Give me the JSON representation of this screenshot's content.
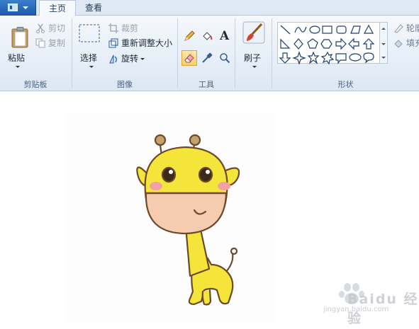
{
  "app_menu": {
    "icon": "paint-app-menu-icon"
  },
  "tabs": [
    {
      "label": "主页",
      "active": true
    },
    {
      "label": "查看",
      "active": false
    }
  ],
  "clipboard": {
    "paste_label": "粘贴",
    "cut_label": "剪切",
    "copy_label": "复制",
    "group_label": "剪贴板"
  },
  "image": {
    "select_label": "选择",
    "crop_label": "裁剪",
    "resize_label": "重新调整大小",
    "rotate_label": "旋转",
    "group_label": "图像"
  },
  "tools": {
    "items": [
      "pencil-icon",
      "fill-icon",
      "text-icon",
      "eraser-icon",
      "color-picker-icon",
      "magnifier-icon"
    ],
    "text_glyph": "A",
    "active": "eraser-icon",
    "group_label": "工具"
  },
  "brushes": {
    "label": "刷子"
  },
  "shapes": {
    "outline_label": "轮廓",
    "fill_label": "填充",
    "group_label": "形状"
  },
  "watermark": {
    "text": "Baidu 经验",
    "url": "jingyan.baidu.com"
  },
  "colors": {
    "accent": "#1b57a9",
    "ribbon": "#dce7f4",
    "giraffe": "#f5e43a"
  }
}
